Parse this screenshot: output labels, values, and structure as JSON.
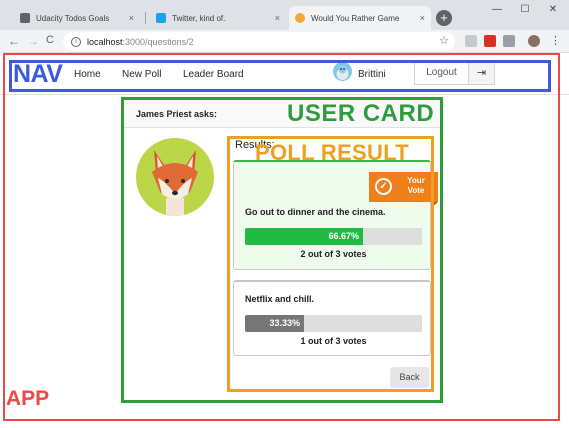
{
  "browser": {
    "tabs": [
      {
        "title": "Udacity Todos Goals",
        "favicon_color": "#5f6368"
      },
      {
        "title": "Twitter, kind of.",
        "favicon_color": "#1da1f2"
      },
      {
        "title": "Would You Rather Game",
        "favicon_color": "#f2a93b"
      }
    ],
    "close_glyph": "×",
    "new_tab_glyph": "+",
    "window_buttons": {
      "minimize": "—",
      "maximize": "☐",
      "close": "✕"
    },
    "back_glyph": "←",
    "forward_glyph": "→",
    "reload_glyph": "C",
    "url_host": "localhost",
    "url_path": ":3000/questions/2",
    "info_glyph": "i",
    "star_glyph": "☆"
  },
  "annotations": {
    "app_label": "APP",
    "nav_label": "NAV",
    "user_card_label": "USER CARD",
    "poll_result_label": "POLL RESULT"
  },
  "nav": {
    "links": [
      "Home",
      "New Poll",
      "Leader Board"
    ],
    "user_name": "Brittini",
    "logout_label": "Logout",
    "logout_icon": "⇥"
  },
  "card": {
    "asker": "James Priest asks:",
    "results_title": "Results:",
    "back_label": "Back"
  },
  "results": {
    "badge_text": "Your Vote",
    "badge_icon": "✓",
    "options": [
      {
        "text": "Go out to dinner and the cinema.",
        "percent_label": "66.67%",
        "fraction": 0.6667,
        "votes_label": "2 out of 3 votes",
        "voted": true,
        "color": "#21ba45"
      },
      {
        "text": "Netflix and chill.",
        "percent_label": "33.33%",
        "fraction": 0.3333,
        "votes_label": "1 out of 3 votes",
        "voted": false,
        "color": "#767676"
      }
    ]
  },
  "colors": {
    "app_outline": "#e84a4a",
    "nav_outline": "#3b5bdb",
    "user_card_outline": "#2f9d3e",
    "poll_outline": "#f0a020",
    "badge": "#ef7f1a"
  }
}
